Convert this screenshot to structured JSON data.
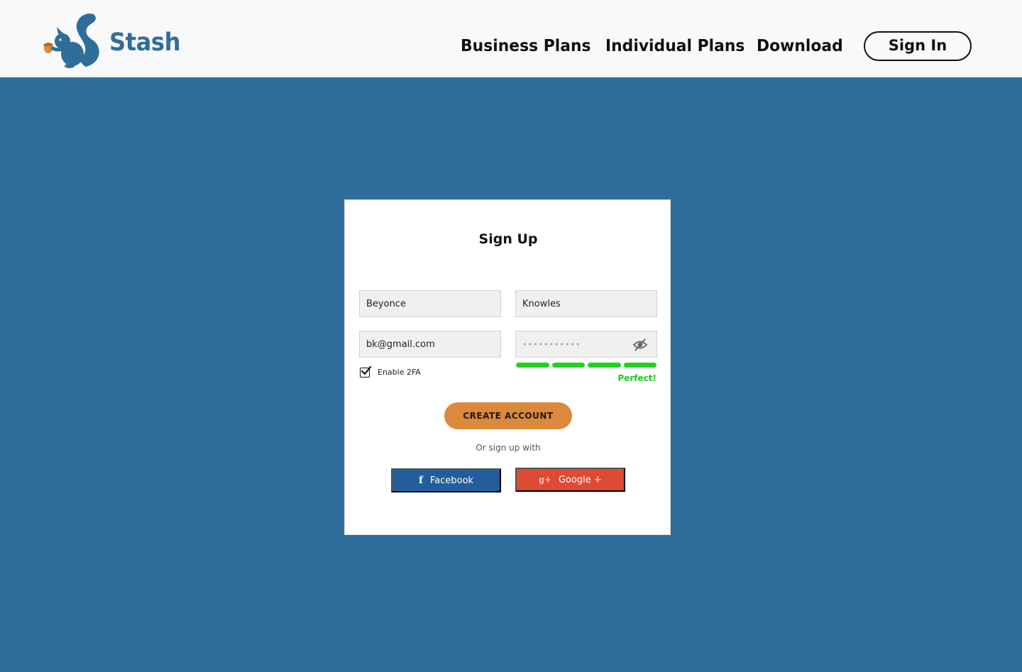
{
  "brand": {
    "name": "Stash",
    "color": "#2f6e9b",
    "accent": "#dc883d"
  },
  "nav": {
    "business_plans": "Business Plans",
    "individual_plans": "Individual Plans",
    "download": "Download",
    "sign_in": "Sign In"
  },
  "form": {
    "title": "Sign Up",
    "first_name": "Beyonce",
    "last_name": "Knowles",
    "email": "bk@gmail.com",
    "password_mask": "•••••••••••",
    "enable_2fa_label": "Enable 2FA",
    "enable_2fa_checked": true,
    "password_strength": {
      "filled_segments": 4,
      "total_segments": 4,
      "label": "Perfect!",
      "color": "#1ec81e"
    },
    "create_account": "CREATE ACCOUNT",
    "or_sign_up_with": "Or sign up with",
    "facebook_label": "Facebook",
    "google_label": "Google +"
  },
  "icons": {
    "logo": "squirrel-icon",
    "password_toggle": "eye-slash-icon",
    "facebook": "facebook-icon",
    "google_plus": "google-plus-icon"
  },
  "colors": {
    "background": "#2f6e9b",
    "facebook": "#245d9b",
    "google": "#de4b34",
    "strength_bar": "#1fd31f"
  }
}
